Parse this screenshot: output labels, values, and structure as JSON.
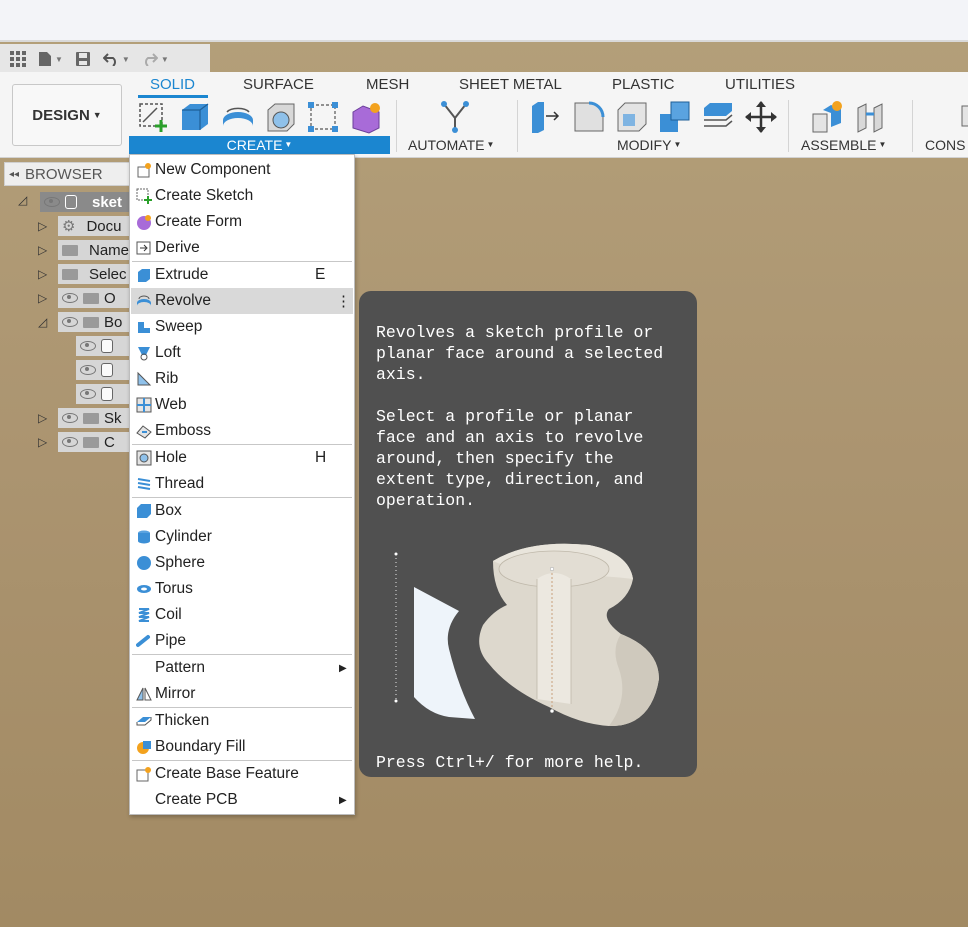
{
  "quickbar": {
    "items": [
      "grid-icon",
      "file-icon",
      "save-icon",
      "undo-icon",
      "redo-icon"
    ]
  },
  "ribbon": {
    "workspace": "DESIGN",
    "tabs": [
      {
        "label": "SOLID",
        "active": true
      },
      {
        "label": "SURFACE"
      },
      {
        "label": "MESH"
      },
      {
        "label": "SHEET METAL"
      },
      {
        "label": "PLASTIC"
      },
      {
        "label": "UTILITIES"
      }
    ],
    "groups": {
      "create": "CREATE",
      "automate": "AUTOMATE",
      "modify": "MODIFY",
      "assemble": "ASSEMBLE",
      "construct": "CONS"
    },
    "accent_color": "#1b86d0"
  },
  "browser": {
    "title": "BROWSER",
    "tree": [
      {
        "label": "sket"
      },
      {
        "label": "Docu"
      },
      {
        "label": "Name"
      },
      {
        "label": "Selec"
      },
      {
        "label": "O"
      },
      {
        "label": "Bo"
      },
      {
        "label": ""
      },
      {
        "label": ""
      },
      {
        "label": ""
      },
      {
        "label": "Sk"
      },
      {
        "label": "C"
      }
    ]
  },
  "menu": {
    "items": [
      {
        "label": "New Component",
        "icon": "new-component-icon"
      },
      {
        "label": "Create Sketch",
        "icon": "create-sketch-icon"
      },
      {
        "label": "Create Form",
        "icon": "create-form-icon"
      },
      {
        "label": "Derive",
        "icon": "derive-icon"
      },
      {
        "label": "Extrude",
        "icon": "extrude-icon",
        "shortcut": "E"
      },
      {
        "label": "Revolve",
        "icon": "revolve-icon",
        "more": "⋮",
        "highlighted": true
      },
      {
        "label": "Sweep",
        "icon": "sweep-icon"
      },
      {
        "label": "Loft",
        "icon": "loft-icon"
      },
      {
        "label": "Rib",
        "icon": "rib-icon"
      },
      {
        "label": "Web",
        "icon": "web-icon"
      },
      {
        "label": "Emboss",
        "icon": "emboss-icon"
      },
      {
        "label": "Hole",
        "icon": "hole-icon",
        "shortcut": "H"
      },
      {
        "label": "Thread",
        "icon": "thread-icon"
      },
      {
        "label": "Box",
        "icon": "box-icon"
      },
      {
        "label": "Cylinder",
        "icon": "cylinder-icon"
      },
      {
        "label": "Sphere",
        "icon": "sphere-icon"
      },
      {
        "label": "Torus",
        "icon": "torus-icon"
      },
      {
        "label": "Coil",
        "icon": "coil-icon"
      },
      {
        "label": "Pipe",
        "icon": "pipe-icon"
      },
      {
        "label": "Pattern",
        "submenu": true
      },
      {
        "label": "Mirror",
        "icon": "mirror-icon"
      },
      {
        "label": "Thicken",
        "icon": "thicken-icon"
      },
      {
        "label": "Boundary Fill",
        "icon": "boundary-fill-icon"
      },
      {
        "label": "Create Base Feature",
        "icon": "base-feature-icon"
      },
      {
        "label": "Create PCB",
        "submenu": true
      }
    ]
  },
  "tooltip": {
    "description": "Revolves a sketch profile or\nplanar face around a selected\naxis.",
    "instructions": "Select a profile or planar\nface and an axis to revolve\naround, then specify the\nextent type, direction, and\noperation.",
    "help": "Press Ctrl+/ for more help."
  }
}
